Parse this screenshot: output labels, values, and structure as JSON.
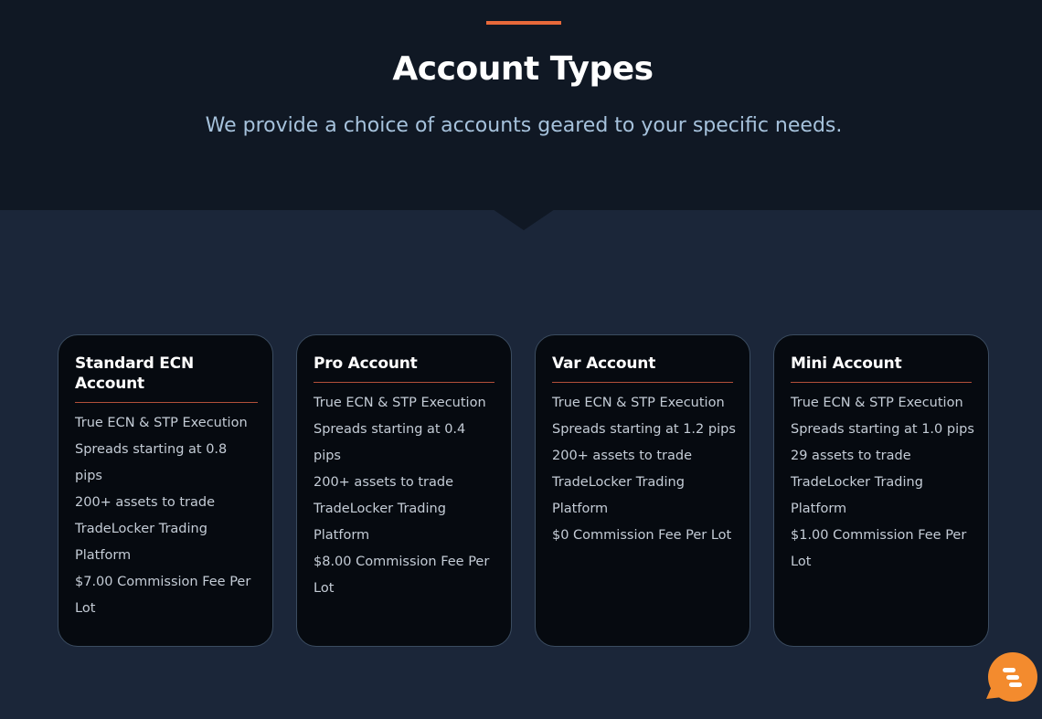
{
  "header": {
    "title": "Account Types",
    "subtitle": "We provide a choice of accounts geared to your specific needs."
  },
  "colors": {
    "accent": "#e8693a",
    "hero_bg": "#101824",
    "section_bg": "#1b2639",
    "card_bg": "#060a10",
    "chat_orange": "#f38b2e"
  },
  "accounts": [
    {
      "title": "Standard ECN Account",
      "features": [
        "True ECN & STP Execution",
        "Spreads starting at 0.8 pips",
        "200+ assets to trade",
        "TradeLocker Trading Platform",
        "$7.00 Commission Fee Per Lot"
      ]
    },
    {
      "title": "Pro Account",
      "features": [
        "True ECN & STP Execution",
        "Spreads starting at 0.4 pips",
        "200+ assets to trade",
        "TradeLocker Trading Platform",
        "$8.00 Commission Fee Per Lot"
      ]
    },
    {
      "title": "Var Account",
      "features": [
        "True ECN & STP Execution",
        "Spreads starting at 1.2 pips",
        "200+ assets to trade",
        "TradeLocker Trading Platform",
        "$0 Commission Fee Per Lot"
      ]
    },
    {
      "title": "Mini Account",
      "features": [
        "True ECN & STP Execution",
        "Spreads starting at 1.0 pips",
        "29 assets to trade",
        "TradeLocker Trading Platform",
        "$1.00 Commission Fee Per Lot"
      ]
    }
  ],
  "chat_widget": {
    "icon": "chat-bubble-icon"
  }
}
